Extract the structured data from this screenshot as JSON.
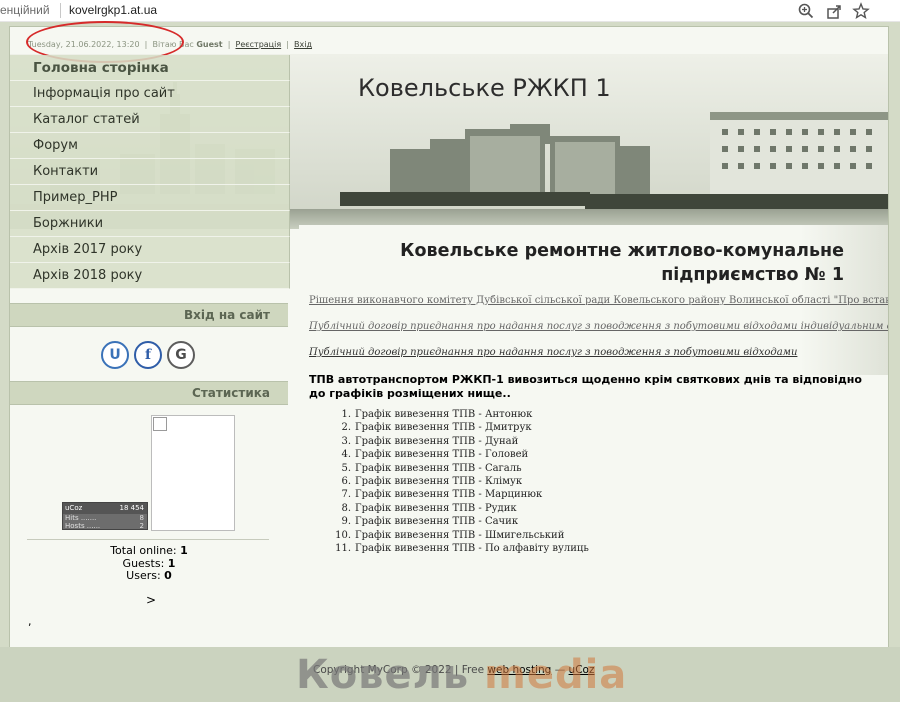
{
  "browser": {
    "security_text": "енційний",
    "url": "kovelrgkp1.at.ua"
  },
  "topinfo": {
    "datetime": "Tuesday, 21.06.2022, 13:20",
    "greeting": "Вітаю Вас",
    "user": "Guest",
    "register": "Реєстрація",
    "login": "Вхід"
  },
  "site": {
    "title": "Ковельське РЖКП 1"
  },
  "nav": {
    "items": [
      {
        "label": "Головна сторінка"
      },
      {
        "label": "Інформація про сайт"
      },
      {
        "label": "Каталог статей"
      },
      {
        "label": "Форум"
      },
      {
        "label": "Контакти"
      },
      {
        "label": "Пример_PHP"
      },
      {
        "label": "Боржники"
      },
      {
        "label": "Архів 2017 року"
      },
      {
        "label": "Архів 2018 року"
      }
    ]
  },
  "sidebar": {
    "login_head": "Вхід на сайт",
    "stats_head": "Статистика",
    "social": [
      "U",
      "f",
      "G"
    ],
    "counter": {
      "brand": "uCoz",
      "total": "18 454",
      "hits_label": "Hits .......",
      "hits": "8",
      "hosts_label": "Hosts ......",
      "hosts": "2"
    },
    "stats": {
      "online_label": "Total online:",
      "online": "1",
      "guests_label": "Guests:",
      "guests": "1",
      "users_label": "Users:",
      "users": "0"
    },
    "arrow": ">",
    "comma": ","
  },
  "content": {
    "title_line1": "Ковельське ремонтне житлово-комунальне",
    "title_line2": "підприємство № 1",
    "links": [
      "Рішення виконавчого комітету Дубівської сільської ради Ковельського району Волинської області \"Про встановлення",
      "Публічний договір приєднання про надання послуг з поводження з побутовими відходами індивідуальним споживачам",
      "Публічний договір приєднання про надання послуг з поводження з побутовими відходами"
    ],
    "intro": "ТПВ автотранспортом РЖКП-1 вивозиться щоденно крім святкових днів та відповідно до графіків розміщених нище..",
    "schedule": [
      "Графік вивезення ТПВ - Антонюк",
      "Графік вивезення ТПВ - Дмитрук",
      "Графік вивезення ТПВ - Дунай",
      "Графік вивезення ТПВ - Головей",
      "Графік вивезення ТПВ - Сагаль",
      "Графік вивезення ТПВ - Клімук",
      "Графік вивезення ТПВ - Марцинюк",
      "Графік вивезення ТПВ - Рудик",
      "Графік вивезення ТПВ - Сачик",
      "Графік вивезення ТПВ - Шмигельський",
      "Графік вивезення ТПВ - По алфавіту вулиць"
    ]
  },
  "footer": {
    "copyright": "Copyright MyCorp © 2022 | Free",
    "hosting": "web hosting",
    "dash": "—",
    "ucoz": "uCoz",
    "watermark_a": "Ковель",
    "watermark_b": "media"
  }
}
